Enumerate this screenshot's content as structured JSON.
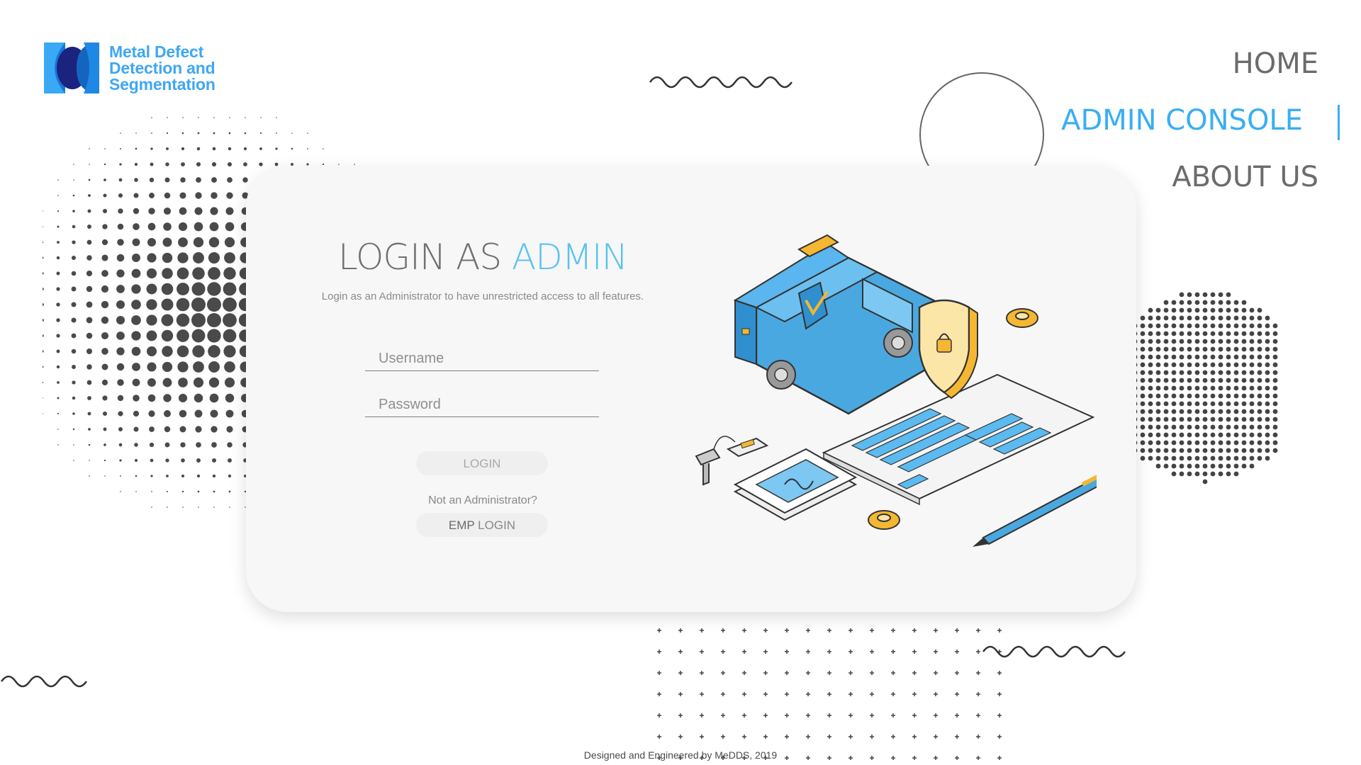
{
  "brand": {
    "line1": "Metal Defect",
    "line2": "Detection and",
    "line3": "Segmentation",
    "accent_color": "#3ea7f2"
  },
  "nav": {
    "items": [
      {
        "label": "HOME",
        "active": false
      },
      {
        "label": "ADMIN CONSOLE",
        "active": true
      },
      {
        "label": "ABOUT US",
        "active": false
      }
    ]
  },
  "login": {
    "title_prefix": "LOGIN AS ",
    "title_accent": "ADMIN",
    "subtitle": "Login as an Administrator to have unrestricted access to all features.",
    "username_placeholder": "Username",
    "password_placeholder": "Password",
    "login_button": "LOGIN",
    "not_admin_text": "Not an Administrator?",
    "emp_button_strong": "EMP",
    "emp_button_rest": " LOGIN"
  },
  "footer": {
    "text": "Designed and Engineered by MeDDS, 2019"
  },
  "colors": {
    "accent": "#38aef4",
    "card_bg": "#f7f7f7",
    "text_gray": "#6b6b6b"
  }
}
